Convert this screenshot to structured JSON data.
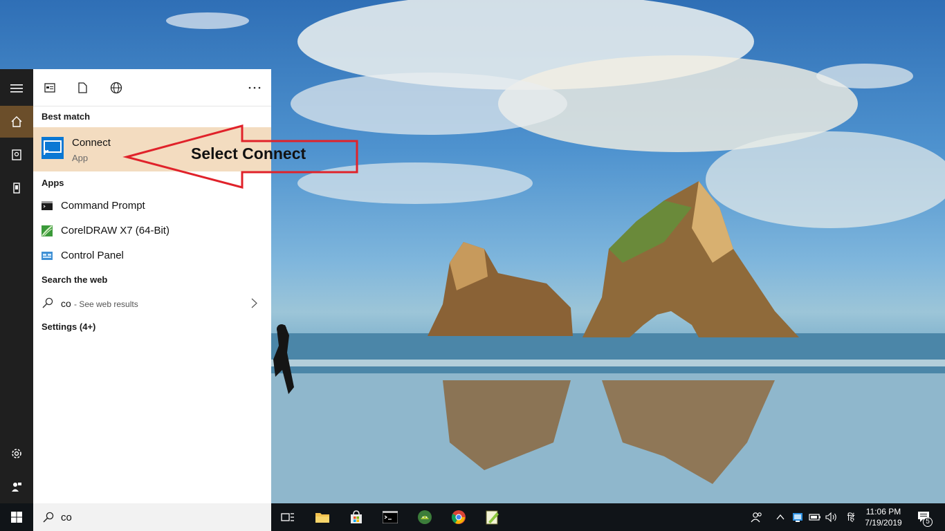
{
  "start_menu": {
    "best_match_heading": "Best match",
    "best_match": {
      "name": "Connect",
      "type": "App"
    },
    "apps_heading": "Apps",
    "apps": [
      {
        "name": "Command Prompt",
        "icon": "command-prompt-icon"
      },
      {
        "name": "CorelDRAW X7 (64-Bit)",
        "icon": "coreldraw-icon"
      },
      {
        "name": "Control Panel",
        "icon": "control-panel-icon"
      }
    ],
    "web_heading": "Search the web",
    "web_result": {
      "query": "co",
      "suffix": " - See web results"
    },
    "settings_heading": "Settings (4+)"
  },
  "search_box": {
    "value": "co"
  },
  "annotation": {
    "text": "Select Connect",
    "color": "#e0222a"
  },
  "tray": {
    "language": "हिं",
    "time": "11:06 PM",
    "date": "7/19/2019",
    "notification_count": "5"
  },
  "colors": {
    "best_match_highlight": "#f3dcc0",
    "rail_active": "#6b4e2a",
    "rail_background": "#1f1f1f",
    "taskbar": "#101418"
  }
}
